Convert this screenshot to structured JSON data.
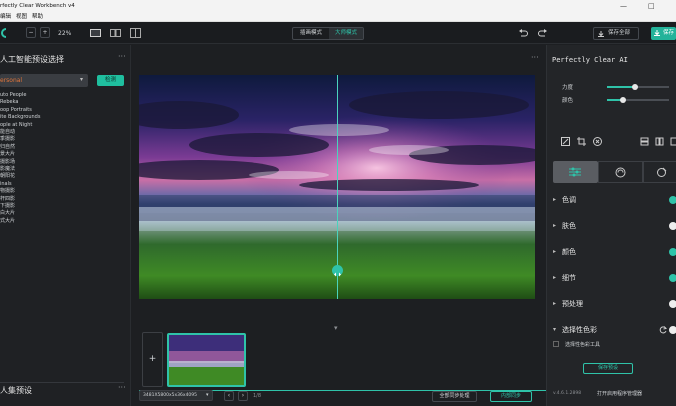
{
  "window": {
    "title": "rfectly Clear Workbench v4",
    "controls": {
      "minimize": "—",
      "maximize": "□"
    }
  },
  "menu": {
    "items": [
      "编辑",
      "视图",
      "帮助"
    ]
  },
  "toolbar": {
    "zoom": "22%",
    "zoom_minus": "−",
    "zoom_plus": "+",
    "mode_tabs": [
      "插画模式",
      "大师模式"
    ],
    "save_all_label": "保存全部",
    "save_label": "保存"
  },
  "left_panel": {
    "ai_preset_title": "人工智能预设选择",
    "preset_dropdown_value": "ersonal",
    "detect_button": "检测",
    "presets": [
      "uto People",
      "Rebeka",
      "oop Portraits",
      "ite Backgrounds",
      "ople at Night",
      "能自动",
      "季摄影",
      "归自然",
      "景大片",
      "摄影场",
      "影魔法",
      "朝阳花",
      "inals",
      "物摄影",
      "杆四影",
      "下摄影",
      "白大片",
      "式大片"
    ],
    "bottom_title": "人集预设"
  },
  "center": {
    "filmstrip_add": "+",
    "image_dims": "3481X5800x5x36x4095",
    "page_info": "1/8",
    "apply_all_label": "全部同步处理",
    "sync_button": "内部同步"
  },
  "right_panel": {
    "brand": "Perfectly Clear AI",
    "sliders": [
      {
        "label": "力度",
        "value": 0.45
      },
      {
        "label": "颜色",
        "value": 0.25
      }
    ],
    "sections": [
      {
        "label": "色调",
        "toggle": "on"
      },
      {
        "label": "肤色",
        "toggle": "off"
      },
      {
        "label": "颜色",
        "toggle": "on"
      },
      {
        "label": "细节",
        "toggle": "on"
      },
      {
        "label": "预处理",
        "toggle": "off"
      },
      {
        "label": "选择性色彩",
        "toggle": "off"
      }
    ],
    "selective_tool_label": "选择性色彩工具",
    "save_preset_button": "保存预设",
    "version": "v.4.6.1.2898",
    "open_manager_link": "打开启用程序管理器"
  },
  "colors": {
    "accent": "#2fc3a9",
    "save_button": "#23b39a",
    "detect_button": "#1fbf9f"
  }
}
